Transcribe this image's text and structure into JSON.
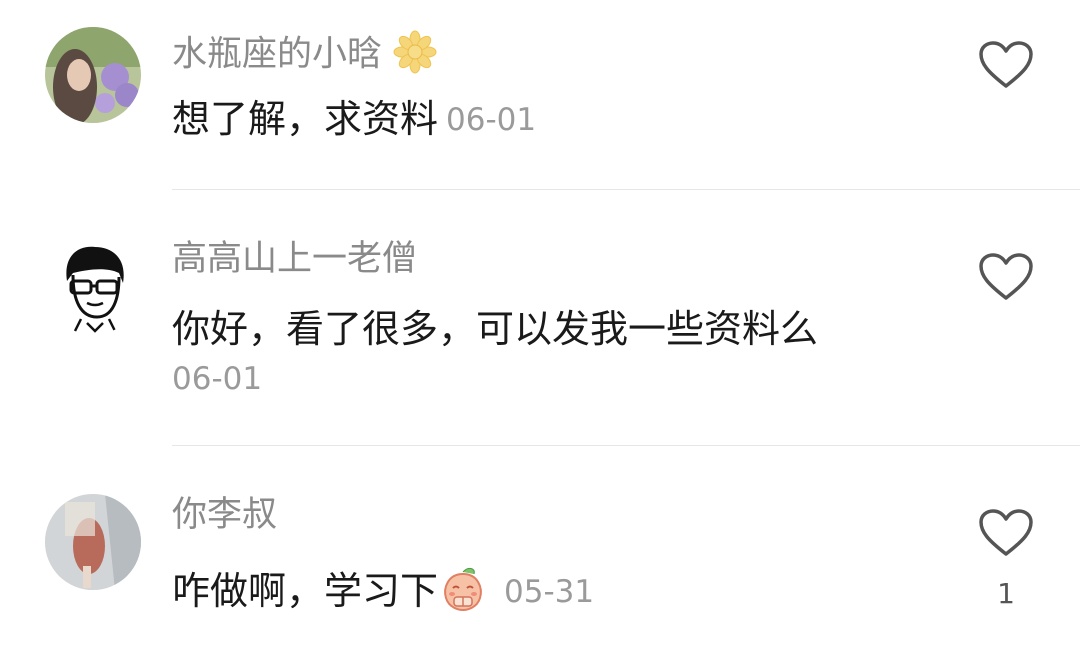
{
  "comments": [
    {
      "username": "水瓶座的小晗",
      "username_emoji": "flower-emoji",
      "text": "想了解，求资料",
      "date": "06-01",
      "like_count": ""
    },
    {
      "username": "高高山上一老僧",
      "text": "你好，看了很多，可以发我一些资料么",
      "date": "06-01",
      "like_count": ""
    },
    {
      "username": "你李叔",
      "text": "咋做啊，学习下",
      "text_emoji": "peach-bow-emoji",
      "date": "05-31",
      "like_count": "1"
    }
  ],
  "colors": {
    "username": "#8a8a8a",
    "text": "#1a1a1a",
    "date": "#9a9a9a",
    "divider": "#e6e6e6",
    "heart_outline": "#555555"
  }
}
